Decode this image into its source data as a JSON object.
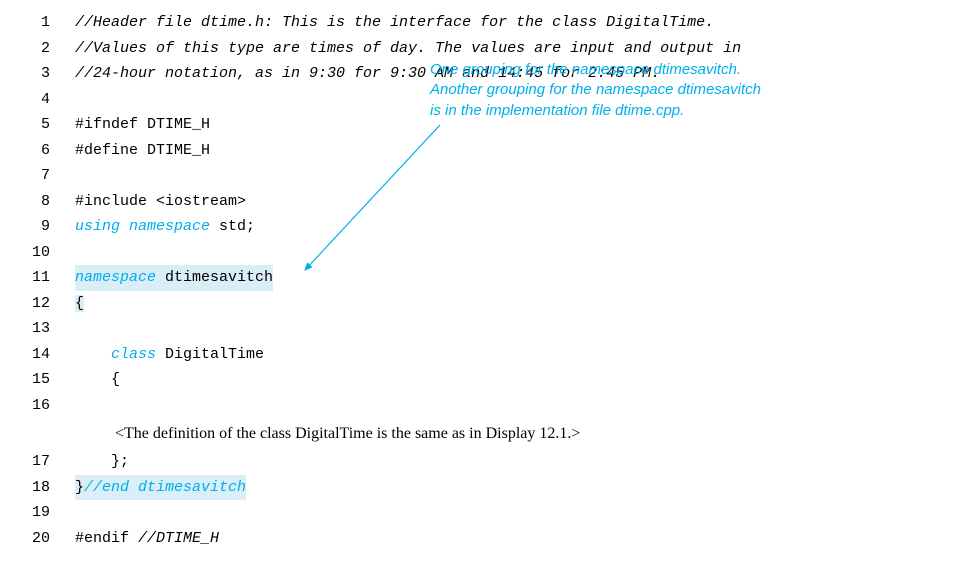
{
  "lines": {
    "l1": {
      "no": "1",
      "pre": "",
      "text": "//Header file dtime.h: This is the interface for the class DigitalTime."
    },
    "l2": {
      "no": "2",
      "pre": "",
      "text": "//Values of this type are times of day. The values are input and output in"
    },
    "l3": {
      "no": "3",
      "pre": "",
      "text": "//24-hour notation, as in 9:30 for 9:30 AM and 14:45 for 2:45 PM."
    },
    "l4": {
      "no": "4"
    },
    "l5": {
      "no": "5",
      "text": "#ifndef DTIME_H"
    },
    "l6": {
      "no": "6",
      "text": "#define DTIME_H"
    },
    "l7": {
      "no": "7"
    },
    "l8": {
      "no": "8",
      "text": "#include <iostream>"
    },
    "l9": {
      "no": "9",
      "kw": "using namespace",
      "rest": " std;"
    },
    "l10": {
      "no": "10"
    },
    "l11": {
      "no": "11",
      "kw": "namespace",
      "rest": " dtimesavitch"
    },
    "l12": {
      "no": "12",
      "text": "{"
    },
    "l13": {
      "no": "13"
    },
    "l14": {
      "no": "14",
      "indent": "    ",
      "kw": "class",
      "rest": " DigitalTime"
    },
    "l15": {
      "no": "15",
      "indent": "    ",
      "text": "{"
    },
    "l16": {
      "no": "16"
    },
    "note": "<The definition of the class DigitalTime is the same as in  Display 12.1.>",
    "l17": {
      "no": "17",
      "indent": "    ",
      "text": "};"
    },
    "l18": {
      "no": "18",
      "brace": "}",
      "comment": "//end dtimesavitch"
    },
    "l19": {
      "no": "19"
    },
    "l20": {
      "no": "20",
      "text": "#endif ",
      "comment": "//DTIME_H"
    }
  },
  "annotation": {
    "line1": "One grouping for the namespace dtimesavitch.",
    "line2": "Another grouping for the namespace dtimesavitch",
    "line3": "is in the implementation file dtime.cpp."
  }
}
